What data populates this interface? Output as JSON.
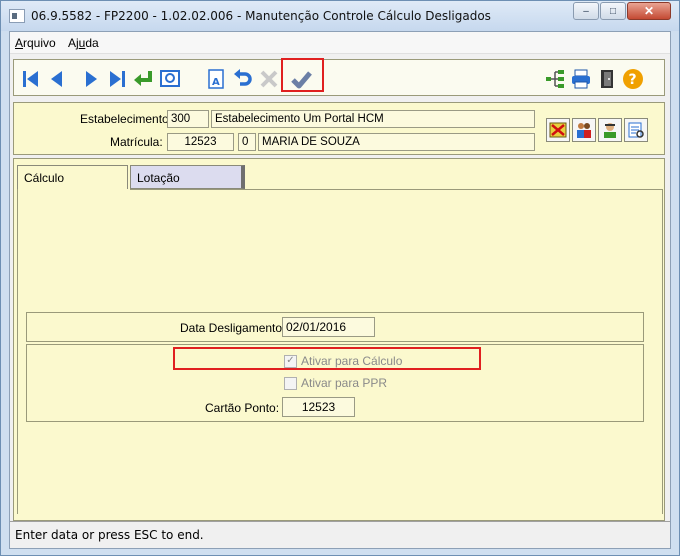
{
  "window": {
    "title": "06.9.5582 - FP2200 - 1.02.02.006 - Manutenção Controle Cálculo Desligados"
  },
  "menu": {
    "items": [
      {
        "label": "Arquivo"
      },
      {
        "label": "Ajuda"
      }
    ]
  },
  "toolbar": {
    "left_icons": [
      "first-icon",
      "prev-icon",
      "next-icon",
      "last-icon",
      "goto-icon",
      "search-icon",
      "edit-icon",
      "undo-icon",
      "delete-icon",
      "confirm-icon"
    ],
    "right_icons": [
      "tree-icon",
      "print-icon",
      "exit-icon",
      "help-icon"
    ],
    "confirm_highlighted": true
  },
  "header": {
    "estabelecimento_label": "Estabelecimento:",
    "estabelecimento_code": "300",
    "estabelecimento_name": "Estabelecimento Um Portal HCM",
    "matricula_label": "Matrícula:",
    "matricula_code": "12523",
    "matricula_digit": "0",
    "matricula_name": "MARIA DE SOUZA",
    "action_icons": [
      "calendar-cancel-icon",
      "people-icon",
      "person-icon",
      "report-icon"
    ]
  },
  "tabs": [
    {
      "label": "Cálculo",
      "active": true
    },
    {
      "label": "Lotação",
      "active": false
    }
  ],
  "form": {
    "data_desligamento_label": "Data Desligamento:",
    "data_desligamento_value": "02/01/2016",
    "ativar_calculo_label": "Ativar para Cálculo",
    "ativar_calculo_checked": true,
    "ativar_ppr_label": "Ativar para PPR",
    "ativar_ppr_checked": false,
    "cartao_ponto_label": "Cartão Ponto:",
    "cartao_ponto_value": "12523"
  },
  "status": {
    "text": "Enter data or press ESC to end."
  },
  "colors": {
    "panel": "#fbf9ce",
    "highlight": "#e02020",
    "toolbar_icon": "#2a6fd1"
  }
}
